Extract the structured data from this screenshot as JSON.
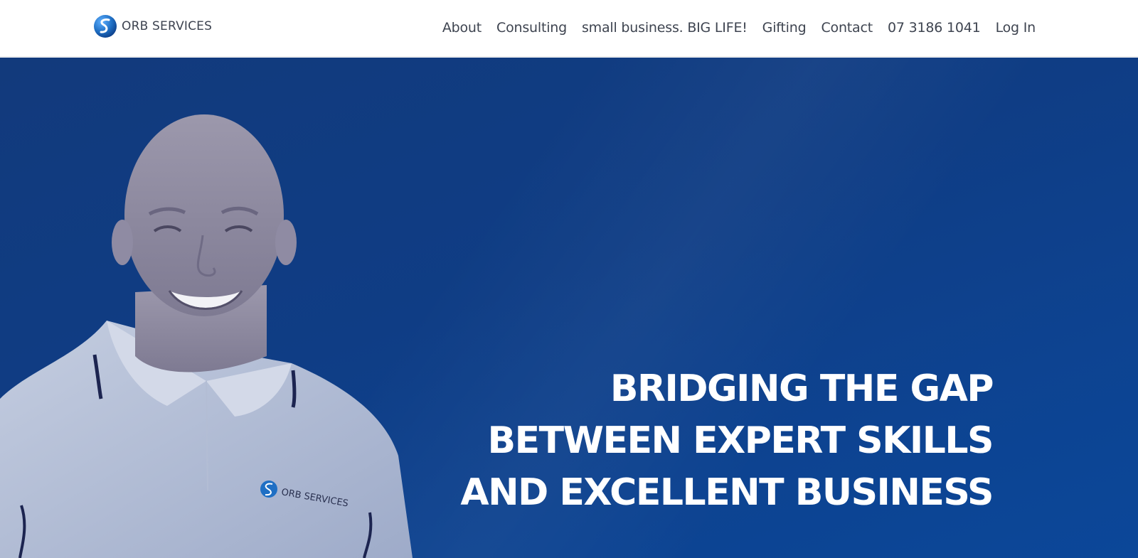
{
  "brand": {
    "name": "ORB SERVICES",
    "logo_icon": "orb-s-logo-icon"
  },
  "nav": {
    "items": [
      {
        "label": "About"
      },
      {
        "label": "Consulting"
      },
      {
        "label": "small business. BIG LIFE!"
      },
      {
        "label": "Gifting"
      },
      {
        "label": "Contact"
      },
      {
        "label": "07 3186 1041"
      },
      {
        "label": "Log In"
      }
    ]
  },
  "hero": {
    "headline_lines": [
      "BRIDGING THE GAP",
      "BETWEEN EXPERT SKILLS",
      "AND EXCELLENT BUSINESS"
    ],
    "shirt_logo_text": "ORB SERVICES"
  },
  "colors": {
    "hero_blue": "#0f3d85",
    "nav_text": "#3e4450",
    "logo_blue": "#1f6fc4"
  }
}
